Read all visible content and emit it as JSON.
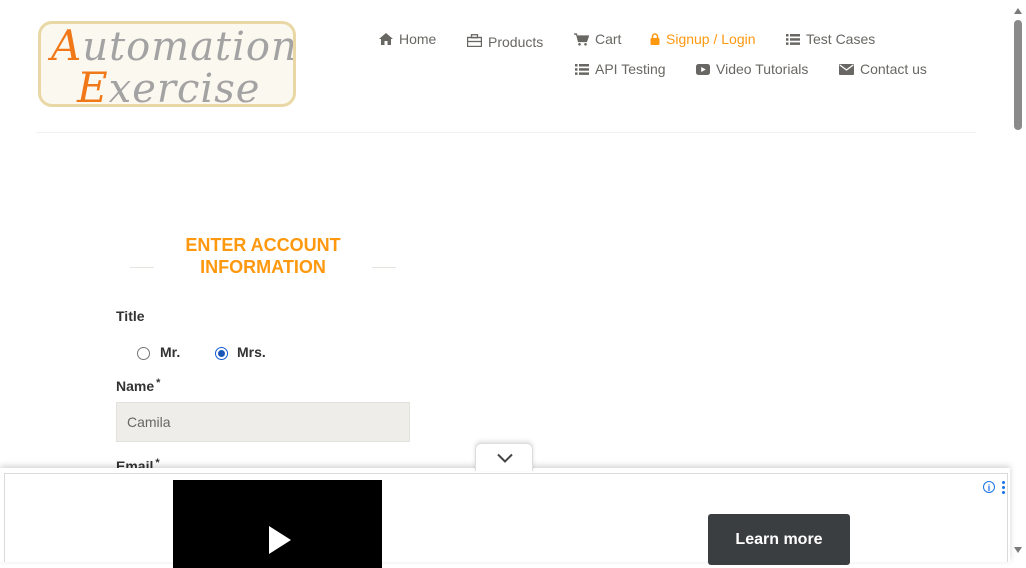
{
  "logo": {
    "line1_cap": "A",
    "line1_rest": "utomation",
    "line2_cap": "E",
    "line2_rest": "xercise"
  },
  "nav": {
    "items": [
      {
        "label": "Home",
        "icon": "home-icon"
      },
      {
        "label": "Products",
        "icon": "products-icon"
      },
      {
        "label": "Cart",
        "icon": "cart-icon"
      },
      {
        "label": "Signup / Login",
        "icon": "lock-icon",
        "active": true
      },
      {
        "label": "Test Cases",
        "icon": "list-icon"
      },
      {
        "label": "API Testing",
        "icon": "list-icon"
      },
      {
        "label": "Video Tutorials",
        "icon": "youtube-play-icon"
      },
      {
        "label": "Contact us",
        "icon": "envelope-icon"
      }
    ]
  },
  "form": {
    "title_line1": "ENTER ACCOUNT",
    "title_line2": "INFORMATION",
    "title_label": "Title",
    "options": [
      {
        "label": "Mr.",
        "checked": false
      },
      {
        "label": "Mrs.",
        "checked": true
      }
    ],
    "name_label": "Name",
    "name_value": "Camila",
    "email_label": "Email",
    "required_mark": "*"
  },
  "ad": {
    "cta_label": "Learn more",
    "info_glyph": "i"
  },
  "colors": {
    "accent": "#fe980f",
    "nav_text": "#696763",
    "input_bg": "#eeede9",
    "cta_bg": "#3b3e40"
  }
}
